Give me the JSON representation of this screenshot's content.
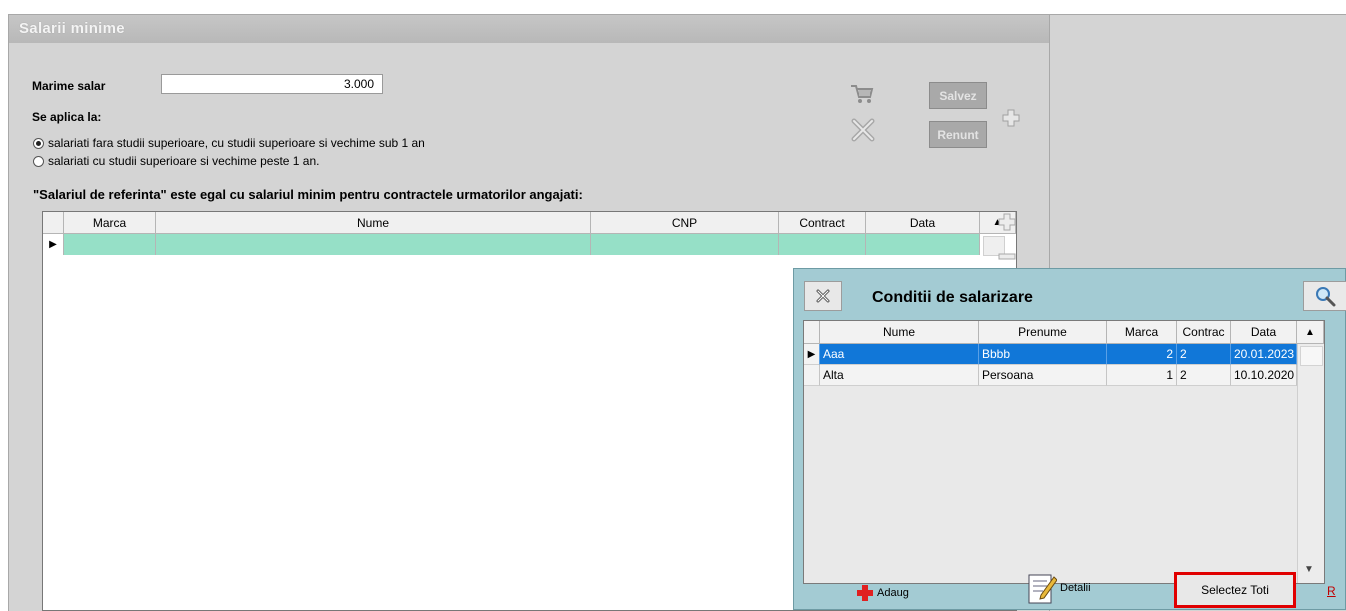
{
  "window": {
    "title": "Salarii minime"
  },
  "form": {
    "marime_label": "Marime salar",
    "marime_value": "3.000",
    "se_aplica_label": "Se aplica la:",
    "option1": "salariati fara studii superioare, cu studii superioare si vechime sub 1 an",
    "option2": "salariati cu studii superioare si vechime peste 1 an.",
    "selected_option": 1,
    "grid_caption": "\"Salariul de referinta\" este egal cu salariul minim pentru contractele urmatorilor angajati:"
  },
  "buttons": {
    "salvez": "Salvez",
    "renunt": "Renunt"
  },
  "main_grid": {
    "columns": [
      "Marca",
      "Nume",
      "CNP",
      "Contract",
      "Data"
    ]
  },
  "popup": {
    "title": "Conditii de salarizare",
    "columns": [
      "Nume",
      "Prenume",
      "Marca",
      "Contrac",
      "Data"
    ],
    "rows": [
      {
        "nume": "Aaa",
        "prenume": "Bbbb",
        "marca": "2",
        "contract": "2",
        "data": "20.01.2023",
        "selected": true
      },
      {
        "nume": "Alta",
        "prenume": "Persoana",
        "marca": "1",
        "contract": "2",
        "data": "10.10.2020",
        "selected": false
      }
    ],
    "toolbar": {
      "adaug": "Adaug",
      "detalii": "Detalii",
      "selectez_toti": "Selectez Toti",
      "cut_label": "R"
    }
  },
  "colors": {
    "grid_row": "#96e0c7",
    "popup_bg": "#a3cbd3",
    "selection": "#1177d8",
    "highlight_border": "#e00000"
  }
}
